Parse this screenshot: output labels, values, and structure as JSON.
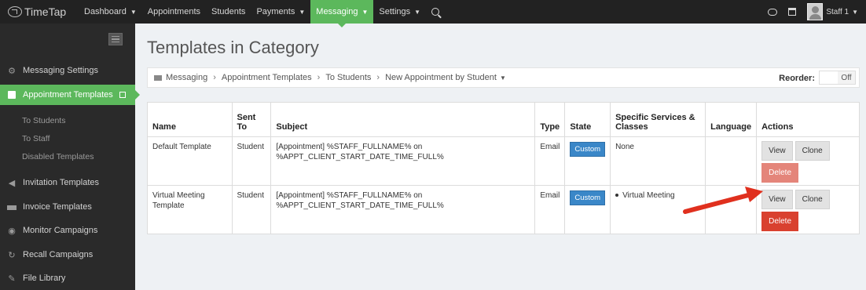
{
  "app": {
    "logo": "TimeTap"
  },
  "nav": {
    "items": [
      {
        "label": "Dashboard",
        "caret": true
      },
      {
        "label": "Appointments",
        "caret": false
      },
      {
        "label": "Students",
        "caret": false
      },
      {
        "label": "Payments",
        "caret": true
      },
      {
        "label": "Messaging",
        "caret": true,
        "active": true
      },
      {
        "label": "Settings",
        "caret": true
      }
    ],
    "user": "Staff 1"
  },
  "sidebar": {
    "messaging_settings": "Messaging Settings",
    "appointment_templates": "Appointment Templates",
    "sub": [
      "To Students",
      "To Staff",
      "Disabled Templates"
    ],
    "invitation_templates": "Invitation Templates",
    "invoice_templates": "Invoice Templates",
    "monitor_campaigns": "Monitor Campaigns",
    "recall_campaigns": "Recall Campaigns",
    "file_library": "File Library"
  },
  "page": {
    "title": "Templates in Category",
    "breadcrumb": [
      "Messaging",
      "Appointment Templates",
      "To Students",
      "New Appointment by Student"
    ],
    "reorder_label": "Reorder:",
    "reorder_state": "Off"
  },
  "table": {
    "headers": {
      "name": "Name",
      "sent_to_1": "Sent",
      "sent_to_2": "To",
      "subject": "Subject",
      "type": "Type",
      "state": "State",
      "services_1": "Specific Services &",
      "services_2": "Classes",
      "language": "Language",
      "actions": "Actions"
    },
    "rows": [
      {
        "name": "Default Template",
        "sent_to": "Student",
        "subject_1": "[Appointment] %STAFF_FULLNAME% on",
        "subject_2": "%APPT_CLIENT_START_DATE_TIME_FULL%",
        "type": "Email",
        "state": "Custom",
        "services": "None",
        "language": ""
      },
      {
        "name_1": "Virtual Meeting",
        "name_2": "Template",
        "sent_to": "Student",
        "subject_1": "[Appointment] %STAFF_FULLNAME% on",
        "subject_2": "%APPT_CLIENT_START_DATE_TIME_FULL%",
        "type": "Email",
        "state": "Custom",
        "services": "Virtual Meeting",
        "language": ""
      }
    ],
    "actions": {
      "view": "View",
      "clone": "Clone",
      "delete": "Delete"
    }
  },
  "colors": {
    "accent_green": "#5cb85c",
    "badge_blue": "#3a87c8",
    "delete_red": "#d9412f",
    "delete_red_light": "#e4857a",
    "arrow_red": "#e0301e"
  }
}
